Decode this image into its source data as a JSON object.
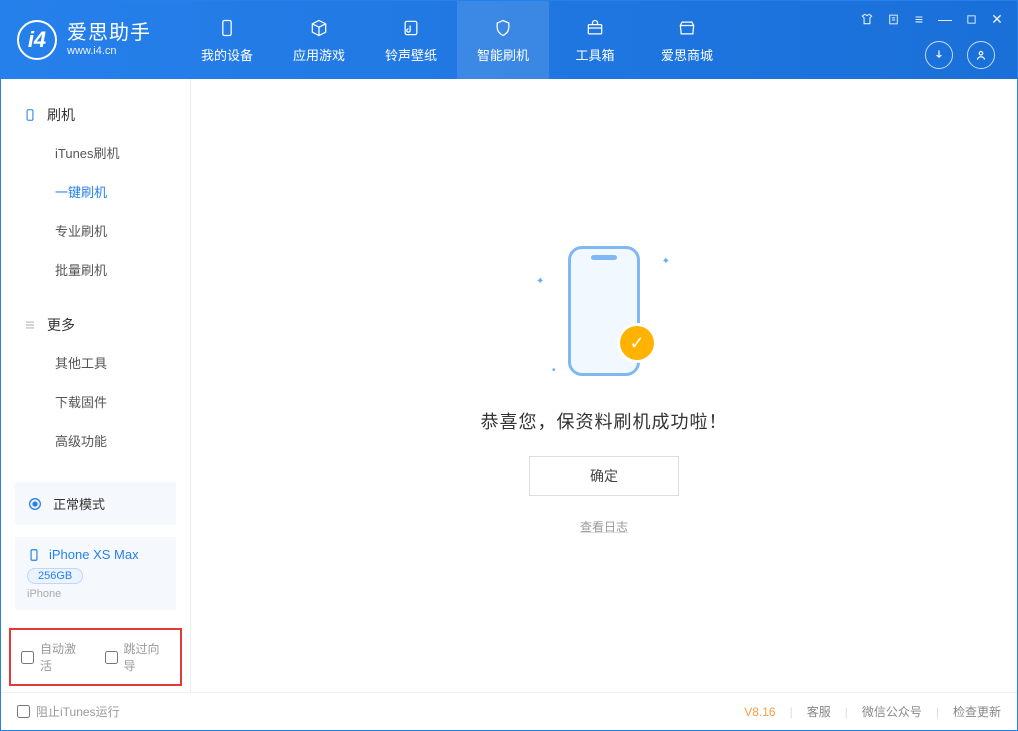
{
  "app": {
    "title": "爱思助手",
    "subtitle": "www.i4.cn"
  },
  "header": {
    "tabs": [
      {
        "id": "device",
        "label": "我的设备"
      },
      {
        "id": "apps",
        "label": "应用游戏"
      },
      {
        "id": "ringtone",
        "label": "铃声壁纸"
      },
      {
        "id": "flash",
        "label": "智能刷机"
      },
      {
        "id": "toolbox",
        "label": "工具箱"
      },
      {
        "id": "store",
        "label": "爱思商城"
      }
    ],
    "active_tab": "flash"
  },
  "sidebar": {
    "groups": [
      {
        "id": "flash",
        "title": "刷机",
        "items": [
          {
            "id": "itunes",
            "label": "iTunes刷机"
          },
          {
            "id": "oneclick",
            "label": "一键刷机"
          },
          {
            "id": "pro",
            "label": "专业刷机"
          },
          {
            "id": "batch",
            "label": "批量刷机"
          }
        ],
        "active": "oneclick"
      },
      {
        "id": "more",
        "title": "更多",
        "items": [
          {
            "id": "other",
            "label": "其他工具"
          },
          {
            "id": "firmware",
            "label": "下载固件"
          },
          {
            "id": "advanced",
            "label": "高级功能"
          }
        ]
      }
    ],
    "mode": {
      "label": "正常模式"
    },
    "device": {
      "name": "iPhone XS Max",
      "storage": "256GB",
      "type": "iPhone"
    },
    "options": {
      "auto_activate_label": "自动激活",
      "skip_guide_label": "跳过向导",
      "auto_activate_checked": false,
      "skip_guide_checked": false
    }
  },
  "main": {
    "message": "恭喜您，保资料刷机成功啦！",
    "ok_label": "确定",
    "log_link": "查看日志"
  },
  "footer": {
    "block_itunes_label": "阻止iTunes运行",
    "block_itunes_checked": false,
    "version": "V8.16",
    "links": [
      {
        "id": "support",
        "label": "客服"
      },
      {
        "id": "wechat",
        "label": "微信公众号"
      },
      {
        "id": "update",
        "label": "检查更新"
      }
    ]
  }
}
